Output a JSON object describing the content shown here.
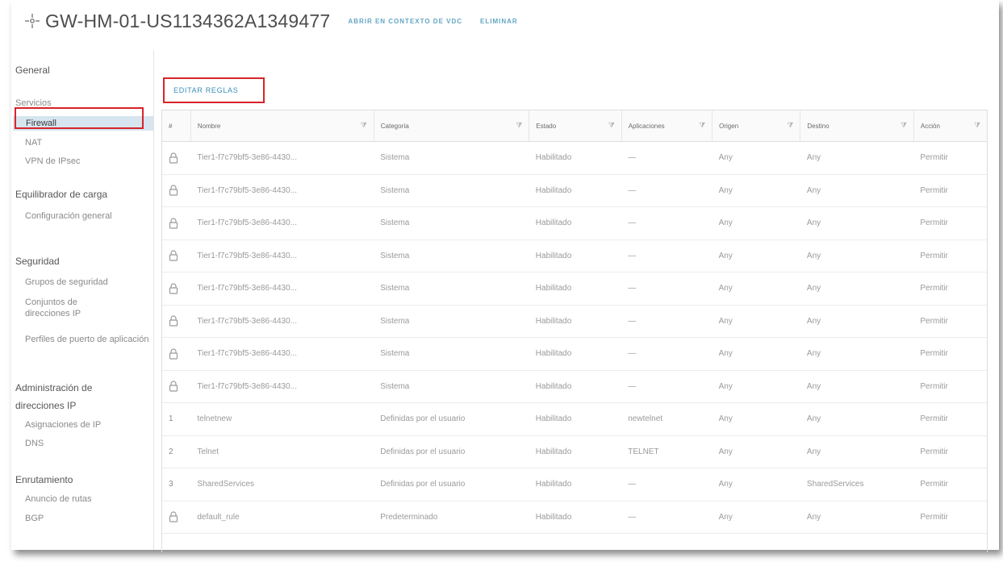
{
  "header": {
    "title": "GW-HM-01-US1134362A1349477",
    "actions": [
      "ABRIR EN CONTEXTO DE VDC",
      "ELIMINAR"
    ]
  },
  "sidebar": {
    "general": "General",
    "services": "Servicios",
    "firewall": "Firewall",
    "nat": "NAT",
    "ipsec": "VPN de IPsec",
    "lb": "Equilibrador de carga",
    "lb_config": "Configuración general",
    "security": "Seguridad",
    "security_groups": "Grupos de seguridad",
    "ip_sets": "Conjuntos de direcciones IP",
    "app_profiles": "Perfiles de puerto de aplicación",
    "ipam": "Administración de direcciones IP",
    "ip_assign": "Asignaciones de IP",
    "dns": "DNS",
    "routing": "Enrutamiento",
    "route_adv": "Anuncio de rutas",
    "bgp": "BGP"
  },
  "edit_rules_label": "EDITAR REGLAS",
  "table": {
    "columns": [
      "#",
      "Nombre",
      "Categoría",
      "Estado",
      "Aplicaciones",
      "Origen",
      "Destino",
      "Acción"
    ],
    "rows": [
      {
        "idx": "",
        "locked": true,
        "name": "Tier1-f7c79bf5-3e86-4430...",
        "category": "Sistema",
        "state": "Habilitado",
        "apps": "—",
        "source": "Any",
        "dest": "Any",
        "action": "Permitir"
      },
      {
        "idx": "",
        "locked": true,
        "name": "Tier1-f7c79bf5-3e86-4430...",
        "category": "Sistema",
        "state": "Habilitado",
        "apps": "—",
        "source": "Any",
        "dest": "Any",
        "action": "Permitir"
      },
      {
        "idx": "",
        "locked": true,
        "name": "Tier1-f7c79bf5-3e86-4430...",
        "category": "Sistema",
        "state": "Habilitado",
        "apps": "—",
        "source": "Any",
        "dest": "Any",
        "action": "Permitir"
      },
      {
        "idx": "",
        "locked": true,
        "name": "Tier1-f7c79bf5-3e86-4430...",
        "category": "Sistema",
        "state": "Habilitado",
        "apps": "—",
        "source": "Any",
        "dest": "Any",
        "action": "Permitir"
      },
      {
        "idx": "",
        "locked": true,
        "name": "Tier1-f7c79bf5-3e86-4430...",
        "category": "Sistema",
        "state": "Habilitado",
        "apps": "—",
        "source": "Any",
        "dest": "Any",
        "action": "Permitir"
      },
      {
        "idx": "",
        "locked": true,
        "name": "Tier1-f7c79bf5-3e86-4430...",
        "category": "Sistema",
        "state": "Habilitado",
        "apps": "—",
        "source": "Any",
        "dest": "Any",
        "action": "Permitir"
      },
      {
        "idx": "",
        "locked": true,
        "name": "Tier1-f7c79bf5-3e86-4430...",
        "category": "Sistema",
        "state": "Habilitado",
        "apps": "—",
        "source": "Any",
        "dest": "Any",
        "action": "Permitir"
      },
      {
        "idx": "",
        "locked": true,
        "name": "Tier1-f7c79bf5-3e86-4430...",
        "category": "Sistema",
        "state": "Habilitado",
        "apps": "—",
        "source": "Any",
        "dest": "Any",
        "action": "Permitir"
      },
      {
        "idx": "1",
        "locked": false,
        "name": "telnetnew",
        "category": "Definidas por el usuario",
        "state": "Habilitado",
        "apps": "newtelnet",
        "source": "Any",
        "dest": "Any",
        "action": "Permitir"
      },
      {
        "idx": "2",
        "locked": false,
        "name": "Telnet",
        "category": "Definidas por el usuario",
        "state": "Habilitado",
        "apps": "TELNET",
        "source": "Any",
        "dest": "Any",
        "action": "Permitir"
      },
      {
        "idx": "3",
        "locked": false,
        "name": "SharedServices",
        "category": "Definidas por el usuario",
        "state": "Habilitado",
        "apps": "—",
        "source": "Any",
        "dest": "SharedServices",
        "action": "Permitir"
      },
      {
        "idx": "",
        "locked": true,
        "name": "default_rule",
        "category": "Predeterminado",
        "state": "Habilitado",
        "apps": "—",
        "source": "Any",
        "dest": "Any",
        "action": "Permitir"
      }
    ]
  },
  "colors": {
    "accent": "#3a8fb7",
    "highlight": "#d8232a",
    "active_bg": "#d6e5f0"
  }
}
